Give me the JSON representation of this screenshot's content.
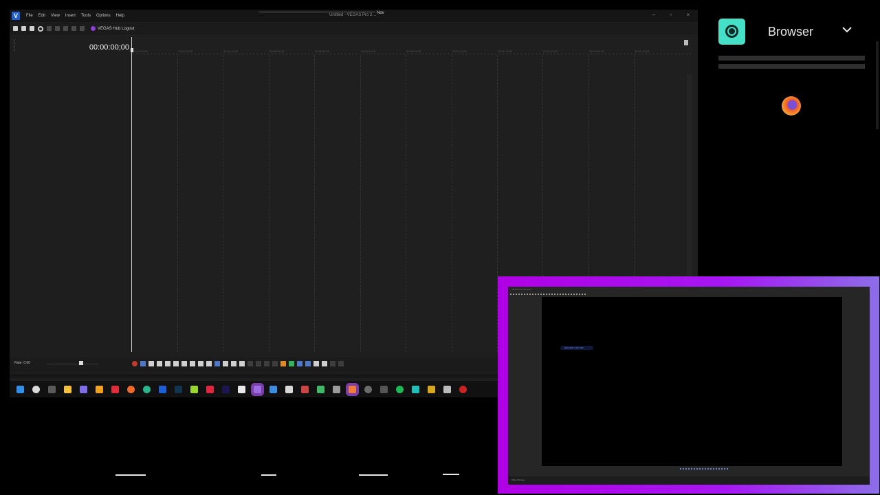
{
  "app": {
    "window_title": "Untitled - VEGAS Pro 2…",
    "title_badge": "Nov",
    "menu": [
      "File",
      "Edit",
      "View",
      "Insert",
      "Tools",
      "Options",
      "Help"
    ],
    "hub_label": "VEGAS Hub Logout",
    "timecode": "00:00:00;00",
    "rate_label": "Rate: 0.00"
  },
  "ruler_ticks": [
    "00:00:00;00",
    "00:00:10;00",
    "00:00:19;29",
    "00:00:29;29",
    "00:00:39;29",
    "00:00:49;29",
    "00:00:59;28",
    "00:01:10;00",
    "00:01:19;29",
    "00:01:29;29",
    "00:01:39;29",
    "00:01:49;29"
  ],
  "browser_panel": {
    "label": "Browser"
  },
  "overlay": {
    "mini_title": "VEGAS Pro Recorder",
    "mini_chip_text": "RECORD: CPU 15%",
    "mini_tab": "Video Preview"
  },
  "colors": {
    "accent_purple": "#b000e6",
    "browser_icon": "#45e1c7",
    "vegas_blue": "#1f5fd6"
  }
}
